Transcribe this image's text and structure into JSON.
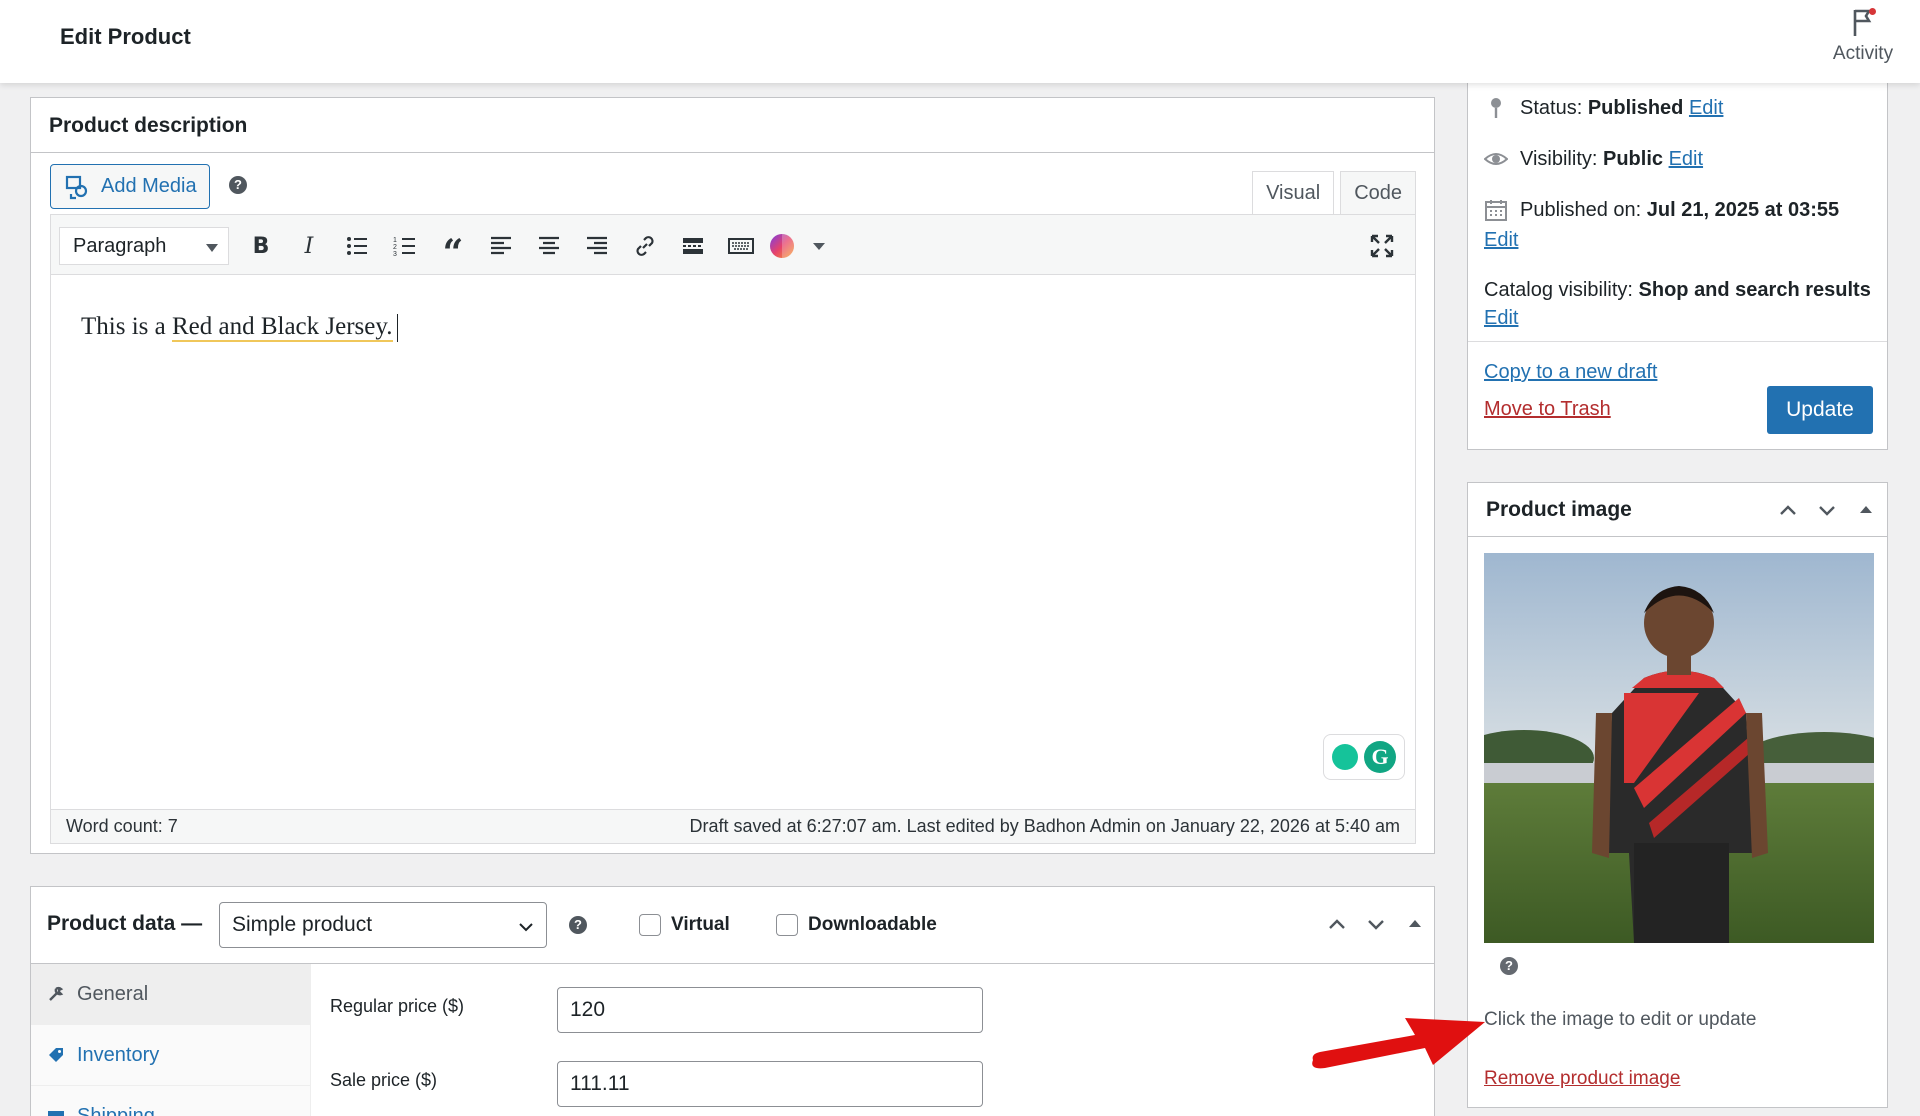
{
  "header": {
    "title": "Edit Product",
    "activity_label": "Activity"
  },
  "description": {
    "title": "Product description",
    "add_media": "Add Media",
    "tabs": [
      "Visual",
      "Code"
    ],
    "format": "Paragraph",
    "content_plain": "This is a ",
    "content_underlined": "Red and Black Jersey.",
    "word_count": "Word count: 7",
    "draft_status": "Draft saved at 6:27:07 am. Last edited by Badhon Admin on January 22, 2026 at 5:40 am"
  },
  "product_data": {
    "title": "Product data —",
    "type": "Simple product",
    "virtual_label": "Virtual",
    "downloadable_label": "Downloadable",
    "tabs": [
      "General",
      "Inventory",
      "Shipping"
    ],
    "regular_price_label": "Regular price ($)",
    "regular_price": "120",
    "sale_price_label": "Sale price ($)",
    "sale_price": "111.11"
  },
  "publish": {
    "status_label": "Status:",
    "status_value": "Published",
    "visibility_label": "Visibility:",
    "visibility_value": "Public",
    "published_label": "Published on:",
    "published_value": "Jul 21, 2025 at 03:55",
    "catalog_label": "Catalog visibility:",
    "catalog_value": "Shop and search results",
    "edit": "Edit",
    "copy_draft": "Copy to a new draft",
    "trash": "Move to Trash",
    "update": "Update"
  },
  "product_image": {
    "title": "Product image",
    "hint": "Click the image to edit or update",
    "remove": "Remove product image"
  },
  "colors": {
    "primary": "#2271b1",
    "danger": "#b32d2e",
    "arrow": "#e01010"
  }
}
